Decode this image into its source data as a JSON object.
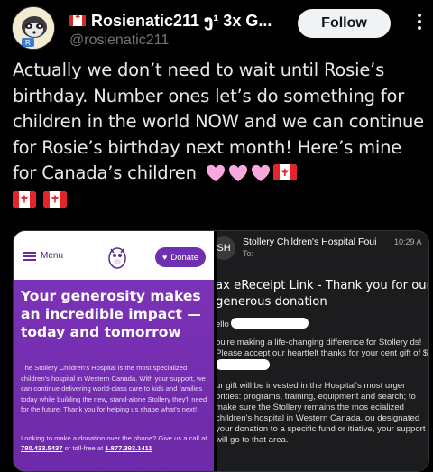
{
  "author": {
    "display_name": "Rosienatic211 ງ¹ 3x G...",
    "handle": "@rosienatic211",
    "avatar_icon": "raccoon-avatar-icon",
    "flag_icon": "canada-flag-icon"
  },
  "actions": {
    "follow_label": "Follow",
    "more_label": "⋮"
  },
  "tweet": {
    "text": "Actually we don’t need to wait until Rosie’s birthday. Number ones let’s do something for children in the world NOW and we can continue for Rosie’s birthday next month! Here’s mine for Canada’s children",
    "emoji": [
      "pink-heart",
      "pink-heart",
      "pink-heart",
      "canada-flag",
      "canada-flag",
      "canada-flag"
    ]
  },
  "website_card": {
    "menu_label": "Menu",
    "donate_label": "Donate",
    "hero_title": "Your generosity makes an incredible impact — today and tomorrow",
    "hero_body": "The Stollery Children's Hospital is the most specialized children's hospital in Western Canada. With your support, we can continue delivering world-class care to kids and families today while building the new, stand-alone Stollery they'll need for the future. Thank you for helping us shape what's next!",
    "cta_text": "Looking to make a donation over the phone? Give us a call at",
    "phone": "780.433.5437",
    "cta_tollfree": "or toll-free at",
    "tollfree": "1.877.393.1411",
    "colors": {
      "purple": "#7b32b7",
      "donate": "#6e2fb0"
    }
  },
  "email_card": {
    "avatar_initials": "SH",
    "sender": "Stollery Children's Hospital Foui",
    "time": "10:29 A",
    "to_label": "To:",
    "subject": "ax eReceipt Link - Thank you for our generous donation",
    "greeting": "ello",
    "para1": "ou're making a life-changing difference for Stollery ds!  Please accept our heartfelt thanks for your cent gift of $",
    "para2": "ur gift will be invested in the Hospital's most urger orities: programs, training, equipment and search; to make sure the Stollery remains the mos ecialized children's hospital in Western Canada. ou designated your donation to a specific fund or itiative, your support will go to that area."
  }
}
